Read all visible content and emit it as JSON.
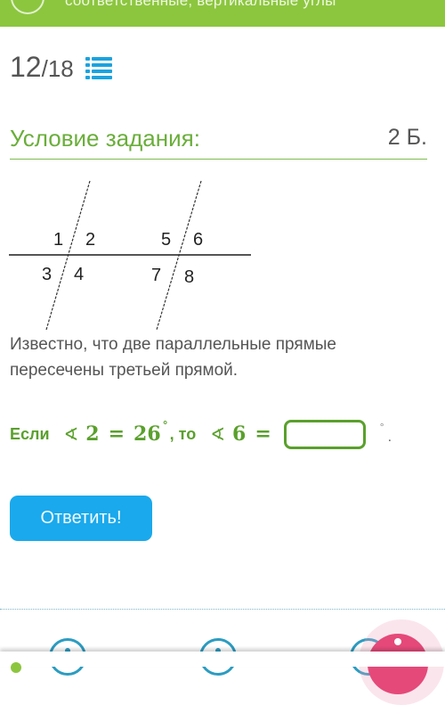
{
  "header": {
    "title": "соответственные, вертикальные углы"
  },
  "progress": {
    "current": "12",
    "separator": "/",
    "total": "18",
    "list_icon": "list-icon"
  },
  "task": {
    "section_title": "Условие задания:",
    "points": "2 Б.",
    "diagram": {
      "labels": [
        "1",
        "2",
        "3",
        "4",
        "5",
        "6",
        "7",
        "8"
      ]
    },
    "statement": "Известно, что две параллельные прямые пересечены третьей прямой.",
    "question": {
      "if_word": "Если",
      "angle_symbol": "∢",
      "given_angle": "2",
      "equals": "=",
      "given_value": "26",
      "degree": "°",
      "comma_then": ", то",
      "target_angle": "6",
      "answer_value": "",
      "answer_placeholder": "",
      "trailing_degree": "°",
      "trailing_period": "."
    }
  },
  "actions": {
    "submit_label": "Ответить!"
  },
  "colors": {
    "brand_green": "#8cc63f",
    "accent_blue": "#1aa9ec",
    "fab_pink": "#e5497a"
  }
}
